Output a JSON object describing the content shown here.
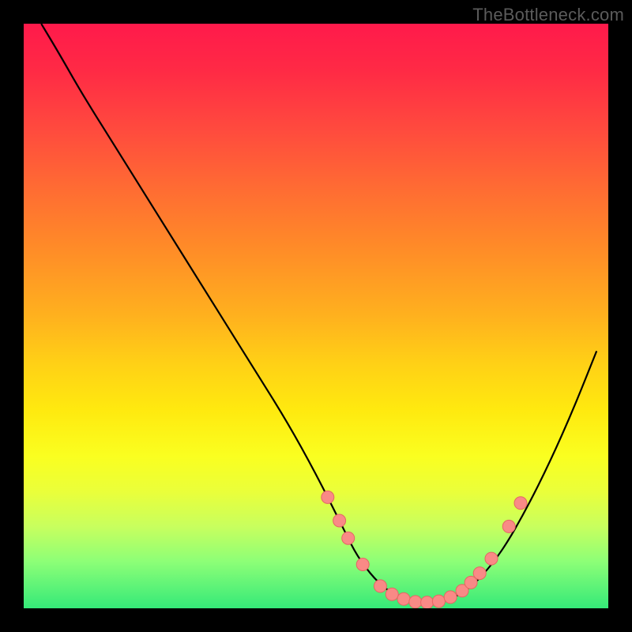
{
  "watermark": "TheBottleneck.com",
  "chart_data": {
    "type": "line",
    "title": "",
    "xlabel": "",
    "ylabel": "",
    "xlim": [
      0,
      100
    ],
    "ylim": [
      0,
      100
    ],
    "grid": false,
    "legend": false,
    "series": [
      {
        "name": "curve",
        "x": [
          3,
          6,
          10,
          15,
          20,
          25,
          30,
          35,
          40,
          45,
          50,
          55,
          57,
          60,
          63,
          66,
          69,
          72,
          75,
          78,
          82,
          86,
          90,
          94,
          98
        ],
        "y": [
          100,
          95,
          88,
          80,
          72,
          64,
          56,
          48,
          40,
          32,
          23,
          13,
          9,
          5,
          2.5,
          1.3,
          1,
          1.3,
          2.5,
          5,
          10,
          17,
          25,
          34,
          44
        ]
      }
    ],
    "markers": [
      {
        "x": 52,
        "y": 19
      },
      {
        "x": 54,
        "y": 15
      },
      {
        "x": 55.5,
        "y": 12
      },
      {
        "x": 58,
        "y": 7.5
      },
      {
        "x": 61,
        "y": 3.8
      },
      {
        "x": 63,
        "y": 2.4
      },
      {
        "x": 65,
        "y": 1.6
      },
      {
        "x": 67,
        "y": 1.1
      },
      {
        "x": 69,
        "y": 1.0
      },
      {
        "x": 71,
        "y": 1.2
      },
      {
        "x": 73,
        "y": 1.9
      },
      {
        "x": 75,
        "y": 3.0
      },
      {
        "x": 76.5,
        "y": 4.4
      },
      {
        "x": 78,
        "y": 6.0
      },
      {
        "x": 80,
        "y": 8.5
      },
      {
        "x": 83,
        "y": 14
      },
      {
        "x": 85,
        "y": 18
      }
    ],
    "colors": {
      "curve_stroke": "#000000",
      "marker_fill": "#f98a86",
      "marker_stroke": "#e46763"
    }
  }
}
